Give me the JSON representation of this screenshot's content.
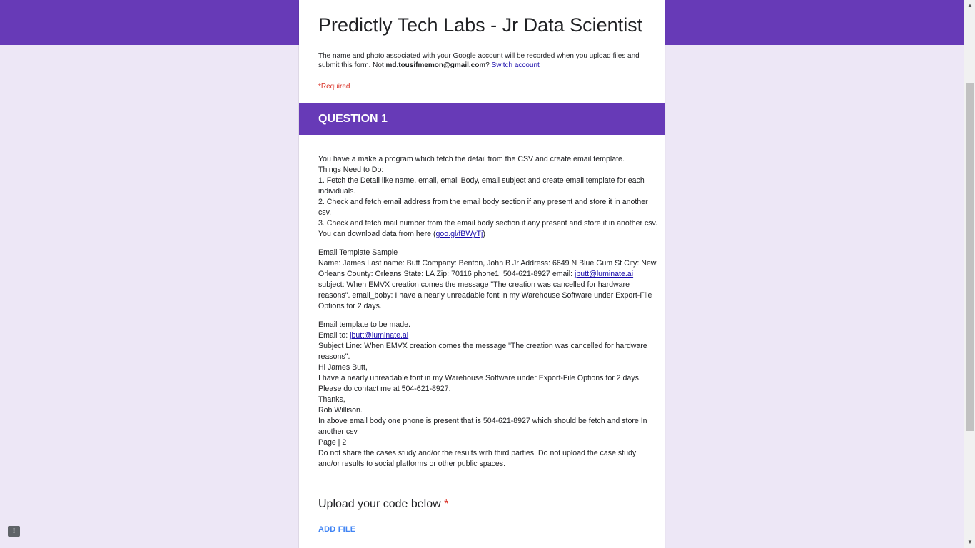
{
  "form": {
    "title": "Predictly Tech Labs - Jr Data Scientist",
    "notice_prefix": "The name and photo associated with your Google account will be recorded when you upload files and submit this form. Not ",
    "account_email": "md.tousifmemon@gmail.com",
    "notice_suffix": "? ",
    "switch_account": "Switch account",
    "required": "*Required"
  },
  "section": {
    "title": "QUESTION 1"
  },
  "description": {
    "p1": [
      "You have a make a program which fetch the detail from the CSV and create email template.",
      "Things Need to Do:",
      "1. Fetch the Detail like name, email, email Body, email subject and create email template for each individuals.",
      "2. Check and fetch email address from the email body section if any present and store it in another csv.",
      "3. Check and fetch mail number from the email body section if any present and store it in another csv."
    ],
    "download_prefix": "You can download data from here (",
    "download_link": "goo.gl/fBWyTj",
    "download_suffix": ")",
    "sample_heading": "Email Template Sample",
    "sample_prefix": "Name: James Last name: Butt Company: Benton, John B Jr Address: 6649 N Blue Gum St City: New Orleans County: Orleans State: LA Zip: 70116 phone1: 504-621-8927 email: ",
    "sample_email": "jbutt@luminate.ai",
    "sample_suffix": " subject: When EMVX creation comes the message \"The creation was cancelled for hardware reasons\". email_boby: I have a nearly unreadable font in my Warehouse Software under Export-File Options for 2 days.",
    "template_heading": "Email template to be made.",
    "email_to_prefix": "Email to: ",
    "email_to_link": "jbutt@luminate.ai",
    "subject_line": "Subject Line: When EMVX creation comes the message \"The creation was cancelled for hardware reasons\".",
    "greeting": "Hi James Butt,",
    "body_line": "I have a nearly unreadable font in my Warehouse Software under Export-File Options for 2 days.",
    "contact_line": "Please do contact me at 504-621-8927.",
    "thanks": "Thanks,",
    "signature": "Rob Willison.",
    "note": "In above email body one phone is present that is 504-621-8927 which should be fetch and store In another csv",
    "page": "Page | 2",
    "disclaimer": "Do not share the cases study and/or the results with third parties. Do not upload the case study and/or results to social platforms or other public spaces."
  },
  "upload": {
    "label": "Upload your code below",
    "required_star": "*",
    "add_file": "ADD FILE"
  },
  "icons": {
    "feedback": "!",
    "scroll_up": "▲",
    "scroll_down": "▼"
  },
  "colors": {
    "brand": "#673ab7",
    "background": "#ede7f6",
    "required": "#d93025",
    "link": "#1a0dab",
    "action": "#4285f4"
  }
}
